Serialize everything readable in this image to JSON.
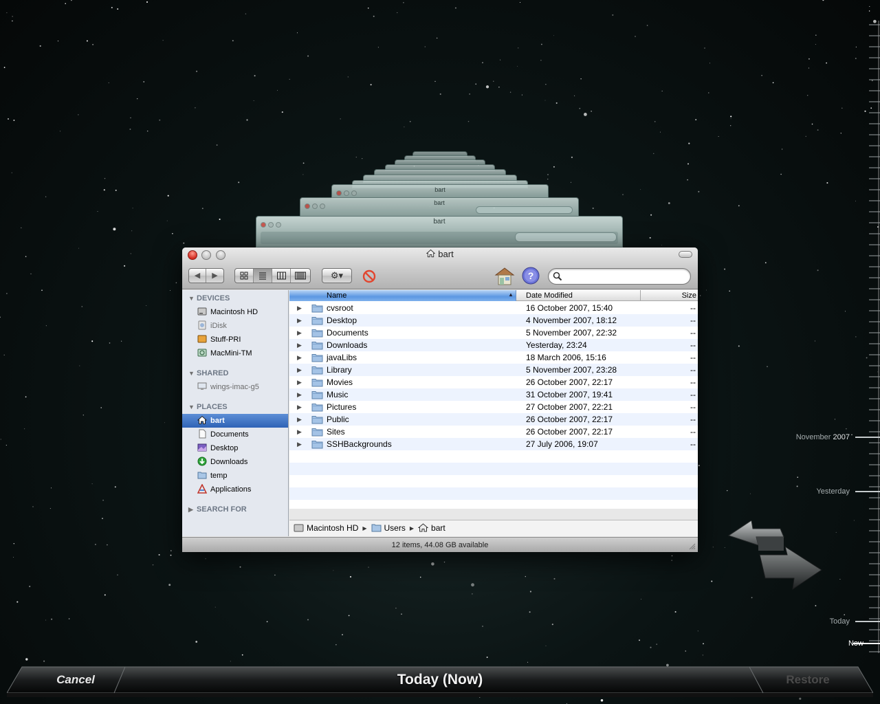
{
  "window": {
    "title": "bart",
    "toolbar": {
      "back": "◀",
      "forward": "▶",
      "views": [
        "icon-view",
        "list-view",
        "column-view",
        "coverflow-view"
      ],
      "action": "⚙▾",
      "search_placeholder": ""
    }
  },
  "sidebar": {
    "devices_header": "DEVICES",
    "devices": [
      "Macintosh HD",
      "iDisk",
      "Stuff-PRI",
      "MacMini-TM"
    ],
    "shared_header": "SHARED",
    "shared": [
      "wings-imac-g5"
    ],
    "places_header": "PLACES",
    "places": [
      "bart",
      "Documents",
      "Desktop",
      "Downloads",
      "temp",
      "Applications"
    ],
    "search_header": "SEARCH FOR"
  },
  "columns": {
    "name": "Name",
    "date": "Date Modified",
    "size": "Size"
  },
  "files": [
    {
      "name": "cvsroot",
      "date": "16 October 2007, 15:40",
      "size": "--"
    },
    {
      "name": "Desktop",
      "date": "4 November 2007, 18:12",
      "size": "--"
    },
    {
      "name": "Documents",
      "date": "5 November 2007, 22:32",
      "size": "--"
    },
    {
      "name": "Downloads",
      "date": "Yesterday, 23:24",
      "size": "--"
    },
    {
      "name": "javaLibs",
      "date": "18 March 2006, 15:16",
      "size": "--"
    },
    {
      "name": "Library",
      "date": "5 November 2007, 23:28",
      "size": "--"
    },
    {
      "name": "Movies",
      "date": "26 October 2007, 22:17",
      "size": "--"
    },
    {
      "name": "Music",
      "date": "31 October 2007, 19:41",
      "size": "--"
    },
    {
      "name": "Pictures",
      "date": "27 October 2007, 22:21",
      "size": "--"
    },
    {
      "name": "Public",
      "date": "26 October 2007, 22:17",
      "size": "--"
    },
    {
      "name": "Sites",
      "date": "26 October 2007, 22:17",
      "size": "--"
    },
    {
      "name": "SSHBackgrounds",
      "date": "27 July 2006, 19:07",
      "size": "--"
    }
  ],
  "pathbar": [
    "Macintosh HD",
    "Users",
    "bart"
  ],
  "status": "12 items, 44.08 GB available",
  "timeline": {
    "month": "November",
    "year": "2007",
    "yesterday": "Yesterday",
    "today": "Today",
    "now": "Now"
  },
  "bottom": {
    "cancel": "Cancel",
    "current": "Today (Now)",
    "restore": "Restore"
  },
  "ghost_titles": [
    "bart",
    "bart",
    "bart"
  ],
  "colors": {
    "selection": "#2f63b6",
    "header_blue": "#5c97e3",
    "background": "#050808"
  }
}
